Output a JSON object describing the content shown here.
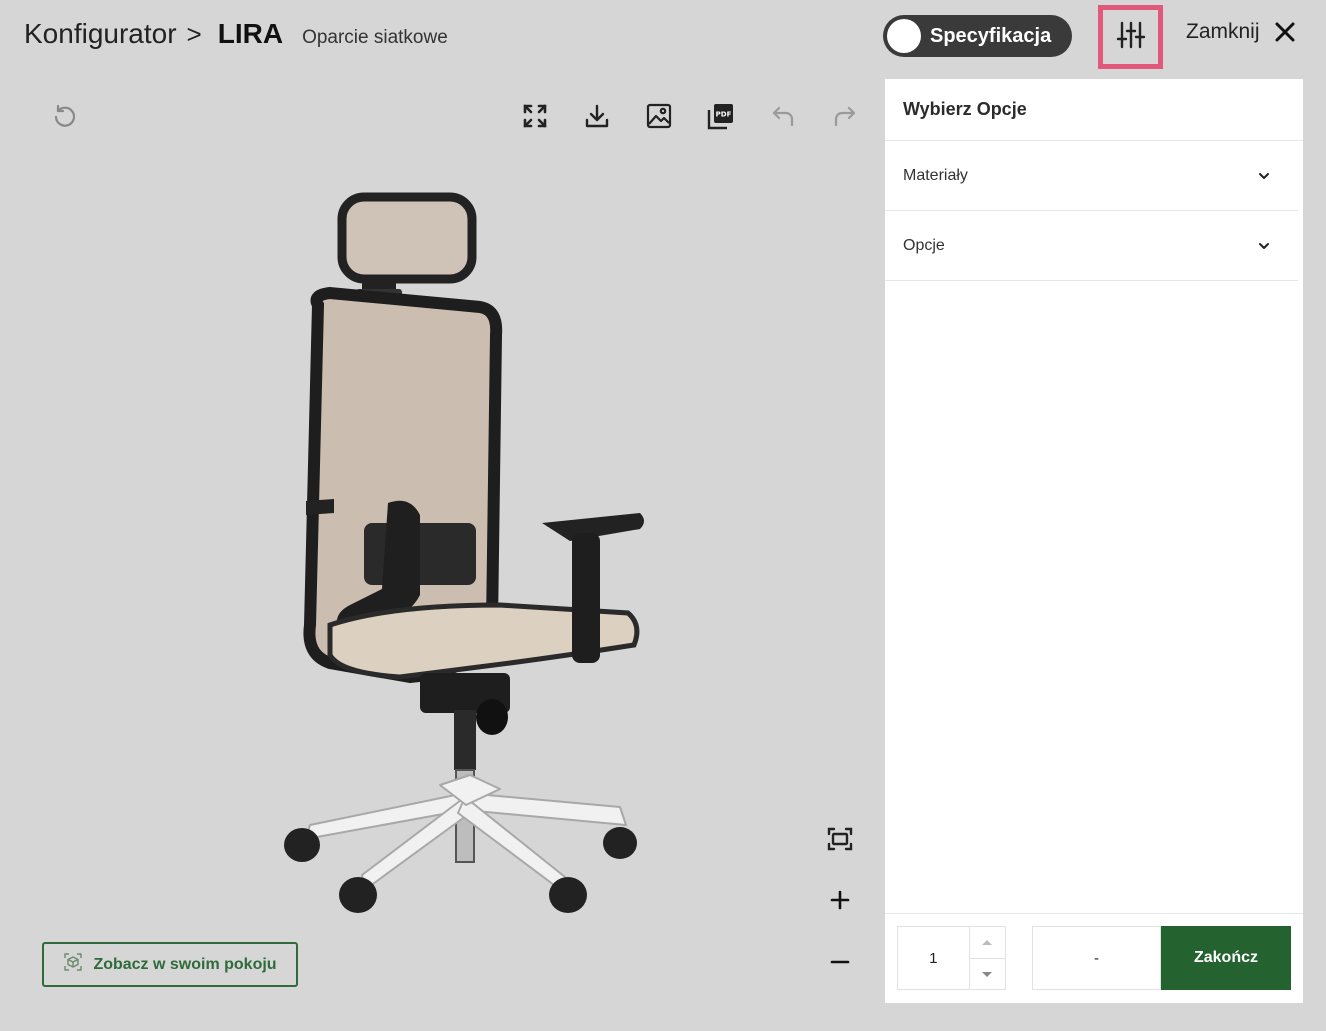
{
  "breadcrumb": {
    "root": "Konfigurator",
    "separator": ">",
    "product": "LIRA",
    "variant": "Oparcie siatkowe"
  },
  "header": {
    "spec_toggle_label": "Specyfikacja",
    "close_label": "Zamknij"
  },
  "toolbar": {
    "icons": [
      "reset-icon",
      "fullscreen-icon",
      "download-icon",
      "image-icon",
      "pdf-icon",
      "undo-icon",
      "redo-icon"
    ],
    "pdf_text": "PDF"
  },
  "view_controls": {
    "icons": [
      "fit-view-icon",
      "zoom-in-icon",
      "zoom-out-icon"
    ]
  },
  "ar_button": {
    "label": "Zobacz w swoim pokoju"
  },
  "panel": {
    "title": "Wybierz Opcje",
    "sections": [
      {
        "label": "Materiały"
      },
      {
        "label": "Opcje"
      }
    ]
  },
  "footer": {
    "quantity": "1",
    "price": "-",
    "finish_label": "Zakończ"
  },
  "colors": {
    "accent": "#24622f",
    "highlight": "#e0587a",
    "background": "#d6d6d6"
  }
}
